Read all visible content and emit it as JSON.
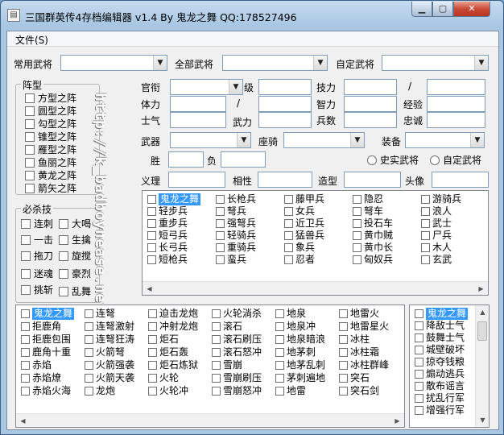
{
  "window": {
    "title": "三国群英传4存档编辑器 v1.4 By 鬼龙之舞 QQ:178527496",
    "app_icon": "app-icon",
    "minimize_icon": "minimize-icon",
    "maximize_icon": "maximize-icon",
    "close_icon": "close-icon"
  },
  "menu": {
    "file": "文件(S)"
  },
  "selectors": {
    "common_label": "常用武将",
    "all_label": "全部武将",
    "custom_label": "自定武将"
  },
  "formation": {
    "title": "阵型",
    "items": [
      "方型之阵",
      "圆型之阵",
      "勾型之阵",
      "锥型之阵",
      "雁型之阵",
      "鱼丽之阵",
      "黄龙之阵",
      "箭矢之阵"
    ]
  },
  "kill_skills": {
    "title": "必杀技",
    "items": [
      "连刺",
      "大喝",
      "一击",
      "生擒",
      "拖刀",
      "旋搅",
      "迷魂",
      "豪烈",
      "挑斩",
      "乱舞"
    ]
  },
  "watermark": "http://k_badboynease.net",
  "fields": {
    "rank": "官衔",
    "level": "级",
    "skill": "技力",
    "slash": "/",
    "hp": "体力",
    "slash2": "/",
    "intellect": "智力",
    "exp": "经验",
    "morale": "士气",
    "force": "武力",
    "troops": "兵数",
    "loyalty": "忠诚",
    "weapon": "武器",
    "mount": "座骑",
    "equip": "装备",
    "win": "胜",
    "lose": "负",
    "radio_real": "史实武将",
    "radio_custom": "自定武将",
    "name": "义理",
    "face": "相性",
    "model": "造型",
    "avatar": "头像"
  },
  "troop_list": {
    "columns": [
      [
        "鬼龙之舞",
        "轻步兵",
        "重步兵",
        "短弓兵",
        "长弓兵",
        "短枪兵"
      ],
      [
        "长枪兵",
        "弩兵",
        "强弩兵",
        "轻骑兵",
        "重骑兵",
        "蛮兵"
      ],
      [
        "藤甲兵",
        "女兵",
        "近卫兵",
        "猛兽兵",
        "象兵",
        "忍者"
      ],
      [
        "隐忍",
        "弩车",
        "投石车",
        "黄巾贼",
        "黄巾长",
        "匈奴兵"
      ],
      [
        "游骑兵",
        "浪人",
        "武士",
        "尸兵",
        "木人",
        "玄武"
      ]
    ]
  },
  "tactic_list": {
    "columns": [
      [
        "鬼龙之舞",
        "拒鹿角",
        "拒鹿包围",
        "鹿角十重",
        "赤焰",
        "赤焰燎",
        "赤焰火海"
      ],
      [
        "连弩",
        "连弩激射",
        "连弩狂涛",
        "火箭弩",
        "火箭强袭",
        "火箭天袭",
        "龙炮"
      ],
      [
        "迫击龙炮",
        "冲射龙炮",
        "炬石",
        "炬石轰",
        "炬石炼狱",
        "火轮",
        "火轮冲"
      ],
      [
        "火轮淌杀",
        "滚石",
        "滚石刷压",
        "滚石怒冲",
        "雪崩",
        "雪崩刷压",
        "雪崩怒冲"
      ],
      [
        "地泉",
        "地泉冲",
        "地泉暗浪",
        "地茅刺",
        "地茅乱刺",
        "茅刺遍地",
        "地雷"
      ],
      [
        "地雷火",
        "地雷星火",
        "冰柱",
        "冰柱霜",
        "冰柱群峰",
        "突石",
        "突石剑"
      ]
    ]
  },
  "right_list": {
    "items": [
      "鬼龙之舞",
      "降敌士气",
      "鼓舞士气",
      "城壁破坏",
      "掠夺钱粮",
      "煽动逃兵",
      "散布谣言",
      "扰乱行军",
      "增强行军"
    ]
  }
}
